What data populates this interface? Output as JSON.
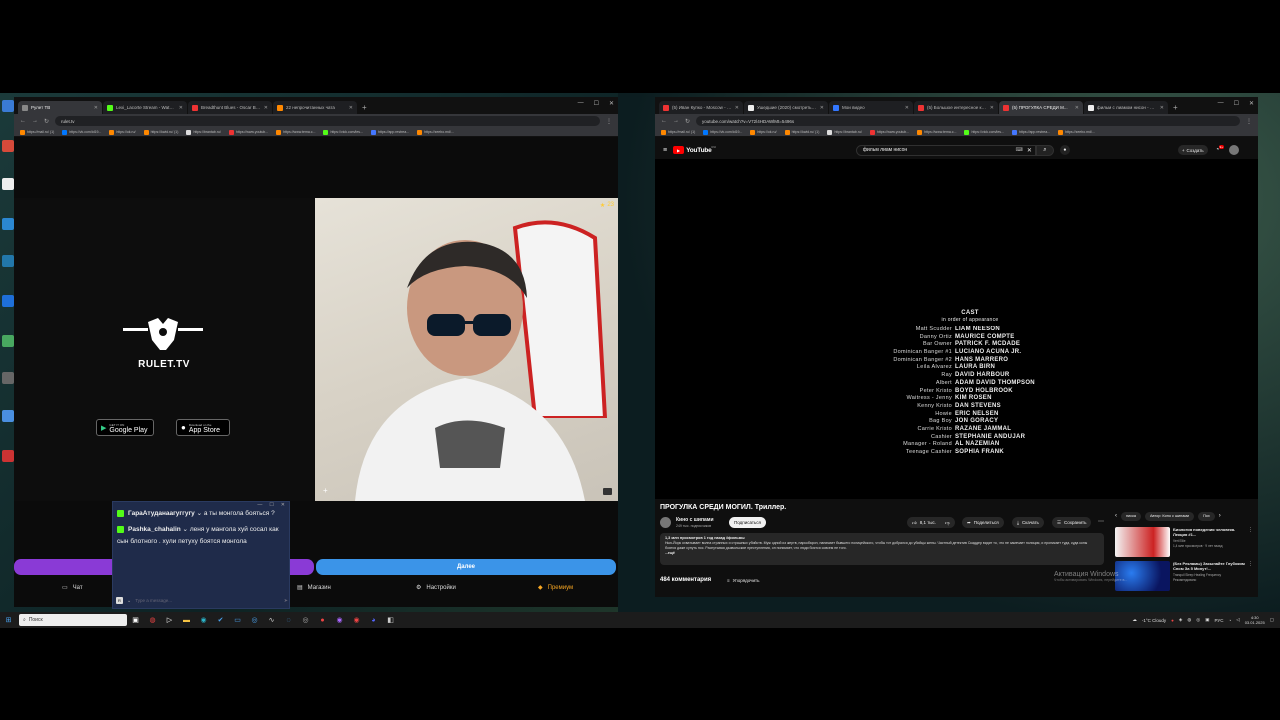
{
  "left_browser": {
    "tabs": [
      {
        "title": "Рулет ТВ",
        "active": true
      },
      {
        "title": "Lexi_Lacorte Stream - Watch Li..."
      },
      {
        "title": "Breadthunt Blues - Oscar Ber..."
      },
      {
        "title": "22 непрочитанных чата"
      }
    ],
    "url": "rulet.tv",
    "bookmarks": [
      "https://mail.ru/ (1)",
      "https://vk.com/id19...",
      "https://ok.ru/",
      "https://kwid.ru/ (1)",
      "https://brantab.ru/",
      "https://www.youtub...",
      "https://www.tema.c...",
      "https://vick.com/les...",
      "https://app.restrea...",
      "https://zeebo.md/..."
    ]
  },
  "rulet": {
    "logo_text": "RULET.TV",
    "google_play": {
      "small": "GET IT ON",
      "big": "Google Play"
    },
    "app_store": {
      "small": "Download on the",
      "big": "App Store"
    },
    "viewer_count": "23",
    "next_button": "Далее",
    "nav": {
      "chat": "Чат",
      "shop": "Магазин",
      "settings": "Настройки",
      "premium": "Премиум"
    }
  },
  "chat_popup": {
    "messages": [
      {
        "user": "ГараАтуданаагуггугу",
        "text": "а ты монгола бояться ?"
      },
      {
        "user": "Pashka_chahalin",
        "text": "леня у мангола хуй сосал как сын блотного . хули петуху боятся монгола"
      }
    ],
    "input_avatar": "R",
    "input_placeholder": "Type a message..."
  },
  "right_browser": {
    "tabs": [
      {
        "title": "(5) Иван Купко - Moscow - Ti..."
      },
      {
        "title": "Ушедшие (2020) смотреть онл..."
      },
      {
        "title": "Мои видео"
      },
      {
        "title": "(5) Большое интересное коро..."
      },
      {
        "title": "(5) ПРОГУЛКА СРЕДИ М...",
        "active": true
      },
      {
        "title": "фильм с лиамом нисон - Пои..."
      }
    ],
    "url": "youtube.com/watch?v=V72l4HDAWlMt=5496s",
    "bookmarks": [
      "https://mail.ru/ (1)",
      "https://vk.com/id19...",
      "https://ok.ru/",
      "https://kwid.ru/ (1)",
      "https://brantab.ru/",
      "https://www.youtub...",
      "https://www.tema.c...",
      "https://vick.com/les...",
      "https://app.restrea...",
      "https://zeebo.md/..."
    ]
  },
  "youtube": {
    "logo": "YouTube",
    "logo_sup": "RU",
    "search_value": "фильм лиам нисон",
    "create_label": "Создать",
    "notif_count": "9+",
    "credits": {
      "heading": "CAST",
      "subheading": "in order of appearance",
      "rows": [
        {
          "role": "Matt Scudder",
          "actor": "LIAM NEESON"
        },
        {
          "role": "Danny Ortiz",
          "actor": "MAURICE COMPTE"
        },
        {
          "role": "Bar Owner",
          "actor": "PATRICK F. MCDADE"
        },
        {
          "role": "Dominican Banger #1",
          "actor": "LUCIANO ACUNA JR."
        },
        {
          "role": "Dominican Banger #2",
          "actor": "HANS MARRERO"
        },
        {
          "role": "Leila Alvarez",
          "actor": "LAURA BIRN"
        },
        {
          "role": "Ray",
          "actor": "DAVID HARBOUR"
        },
        {
          "role": "Albert",
          "actor": "ADAM DAVID THOMPSON"
        },
        {
          "role": "Peter Kristo",
          "actor": "BOYD HOLBROOK"
        },
        {
          "role": "Waitress - Jenny",
          "actor": "KIM ROSEN"
        },
        {
          "role": "Kenny Kristo",
          "actor": "DAN STEVENS"
        },
        {
          "role": "Howie",
          "actor": "ERIC NELSEN"
        },
        {
          "role": "Bag Boy",
          "actor": "JON GORACY"
        },
        {
          "role": "Carrie Kristo",
          "actor": "RAZANE JAMMAL"
        },
        {
          "role": "Cashier",
          "actor": "STEPHANIE ANDUJAR"
        },
        {
          "role": "Manager - Roland",
          "actor": "AL NAZEMIAN"
        },
        {
          "role": "Teenage Cashier",
          "actor": "SOPHIA FRANK"
        }
      ]
    },
    "video_title": "ПРОГУЛКА СРЕДИ МОГИЛ. Триллер.",
    "channel_name": "Кино с шипами",
    "subscribers": "249 тыс. подписчиков",
    "subscribed_label": "Подписаться",
    "likes": "8,1 тыс.",
    "share": "Поделиться",
    "download": "Скачать",
    "save": "Сохранить",
    "desc_meta": "1,3 млн просмотров  1 год назад  #фильмы",
    "desc_text": "Нью-Йорк охватывает волна странных и страшных убийств. Муж одной из жертв, наркобарон, нанимает бывшего полицейского, чтобы тот добрался до убийцы жены. Частный детектив Скаддер видит то, что не замечает полиция, и проникает туда, куда копы боятся даже сунуть нос. Распутывая дьявольские преступления, он понимает, что люди боятся совсем не того.",
    "desc_more": "...ещё",
    "comments": "484 комментария",
    "sort_label": "Упорядочить",
    "chips": [
      "писка",
      "Автор: Кино с шипами",
      "Пох"
    ],
    "recs": [
      {
        "title": "Биология поведения человека. Лекция #1...",
        "channel": "Vert Ellie",
        "meta": "1,4 млн просмотров · 9 лет назад"
      },
      {
        "title": "(Без Рекламы) Засыпайте Глубоким Сном За 5 Минут!...",
        "channel": "Tranquil Sleep Healing Frequency",
        "meta": "Рекомендовано"
      }
    ],
    "activation_line1": "Активация Windows",
    "activation_line2": "Чтобы активировать Windows, перейдите в..."
  },
  "taskbar": {
    "search_placeholder": "Поиск",
    "weather": "-1°C  Cloudy",
    "lang": "РУС",
    "time": "4:30",
    "date": "03.01.2025"
  }
}
